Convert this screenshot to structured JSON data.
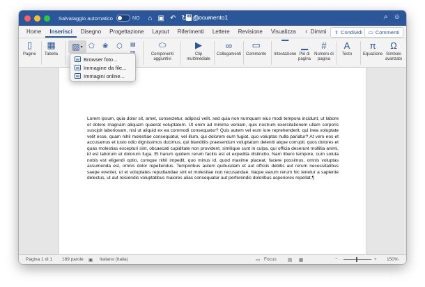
{
  "titlebar": {
    "autosave_label": "Salvataggio automatico",
    "autosave_state": "NO",
    "doc_title": "Documento1",
    "color": "#2b579a"
  },
  "tabs": [
    {
      "label": "Home"
    },
    {
      "label": "Inserisci"
    },
    {
      "label": "Disegno"
    },
    {
      "label": "Progettazione"
    },
    {
      "label": "Layout"
    },
    {
      "label": "Riferimenti"
    },
    {
      "label": "Lettere"
    },
    {
      "label": "Revisione"
    },
    {
      "label": "Visualizza"
    },
    {
      "label": "Dimmi"
    }
  ],
  "active_tab": "Inserisci",
  "share_label": "Condividi",
  "comments_label": "Commenti",
  "ribbon": {
    "pages": "Pagine",
    "table": "Tabella",
    "addins": "Componenti aggiuntivi",
    "media": "Clip multimediale",
    "links": "Collegamenti",
    "comment": "Commento",
    "header": "Intestazione",
    "footer": "Piè di pagina",
    "page_number": "Numero di pagina",
    "text": "Testo",
    "equation": "Equazione",
    "symbol": "Simbolo avanzato"
  },
  "picture_menu": [
    {
      "label": "Browser foto..."
    },
    {
      "label": "Immagine da file..."
    },
    {
      "label": "Immagini online..."
    }
  ],
  "document": {
    "text": "Lorem ipsum, quia dolor sit, amet, consectetur, adipisci velit, sed quia non numquam eius modi tempora incidunt, ut labore et dolore magnam aliquam quaerat voluptatem. Ut enim ad minima veniam, quis nostrum exercitationem ullam corporis suscipit laboriosam, nisi ut aliquid ex ea commodi consequatur? Quis autem vel eum iure reprehenderit, qui inea voluptate velit esse, quam nihil molestiae consequatur, vel illum, qui dolorem eum fugiat, quo voluptas nulla pariatur? At vero eos et accusamus et iusto odio dignissimos ducimus, qui blanditiis praesentium voluptatum deleniti atque corrupti, quos dolores et quas molestias excepturi sint, obcaecati cupiditate non provident, similique sunt in culpa, qui officia deserunt mollitia animi, id est laborum et dolorum fuga. Et harum quidem rerum facilis est et expedita distinctio. Nam libero tempore, cum soluta nobis est eligendi optio, cumque nihil impedit, quo minus id, quod maxime placeat, facere possimus, omnis voluptas assumenda est, omnis dolor repellendus. Temporibus autem quibusdam et aut officiis debitis aut rerum necessitatibus saepe eveniet, ut et voluptates repudiandae sint et molestiae non recusandae. Itaque earum rerum hic tenetur a sapiente delectus, ut aut reiciendis voluptatibus maiores alias consequatur aut perferendis doloribus asperiores repellat.¶"
  },
  "status": {
    "page": "Pagina 1 di 1",
    "words": "189 parole",
    "language": "Italiano (Italia)",
    "focus": "Focus",
    "zoom": "150%"
  }
}
